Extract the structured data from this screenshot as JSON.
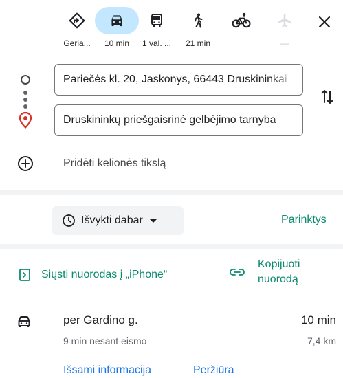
{
  "modes": [
    {
      "name": "best-route",
      "label": "Geria...",
      "icon": "directions-icon",
      "active": false,
      "disabled": false
    },
    {
      "name": "driving",
      "label": "10 min",
      "icon": "car-icon",
      "active": true,
      "disabled": false
    },
    {
      "name": "transit",
      "label": "1 val. ...",
      "icon": "bus-icon",
      "active": false,
      "disabled": false
    },
    {
      "name": "walking",
      "label": "21 min",
      "icon": "walk-icon",
      "active": false,
      "disabled": false
    },
    {
      "name": "cycling",
      "label": "",
      "icon": "bike-icon",
      "active": false,
      "disabled": false
    },
    {
      "name": "flight",
      "label": "—",
      "icon": "airplane-icon",
      "active": false,
      "disabled": true
    }
  ],
  "origin": {
    "value": "Pariečės kl. 20, Jaskonys, 66443 Druskininkai"
  },
  "destination": {
    "value": "Druskininkų priešgaisrinė gelbėjimo tarnyba"
  },
  "add_destination": "Pridėti kelionės tikslą",
  "depart": {
    "label": "Išvykti dabar"
  },
  "options_label": "Parinktys",
  "send_to_phone": "Siųsti nuorodas į „iPhone“",
  "copy_link_line1": "Kopijuoti",
  "copy_link_line2": "nuorodą",
  "route": {
    "title": "per Gardino g.",
    "duration": "10 min",
    "traffic": "9 min nesant eismo",
    "distance": "7,4 km",
    "details_label": "Išsami informacija",
    "preview_label": "Peržiūra"
  },
  "colors": {
    "accent_blue": "#1a73e8",
    "accent_green": "#0b8a6f",
    "active_chip": "#c2e7ff",
    "destination_pin": "#d93025"
  }
}
